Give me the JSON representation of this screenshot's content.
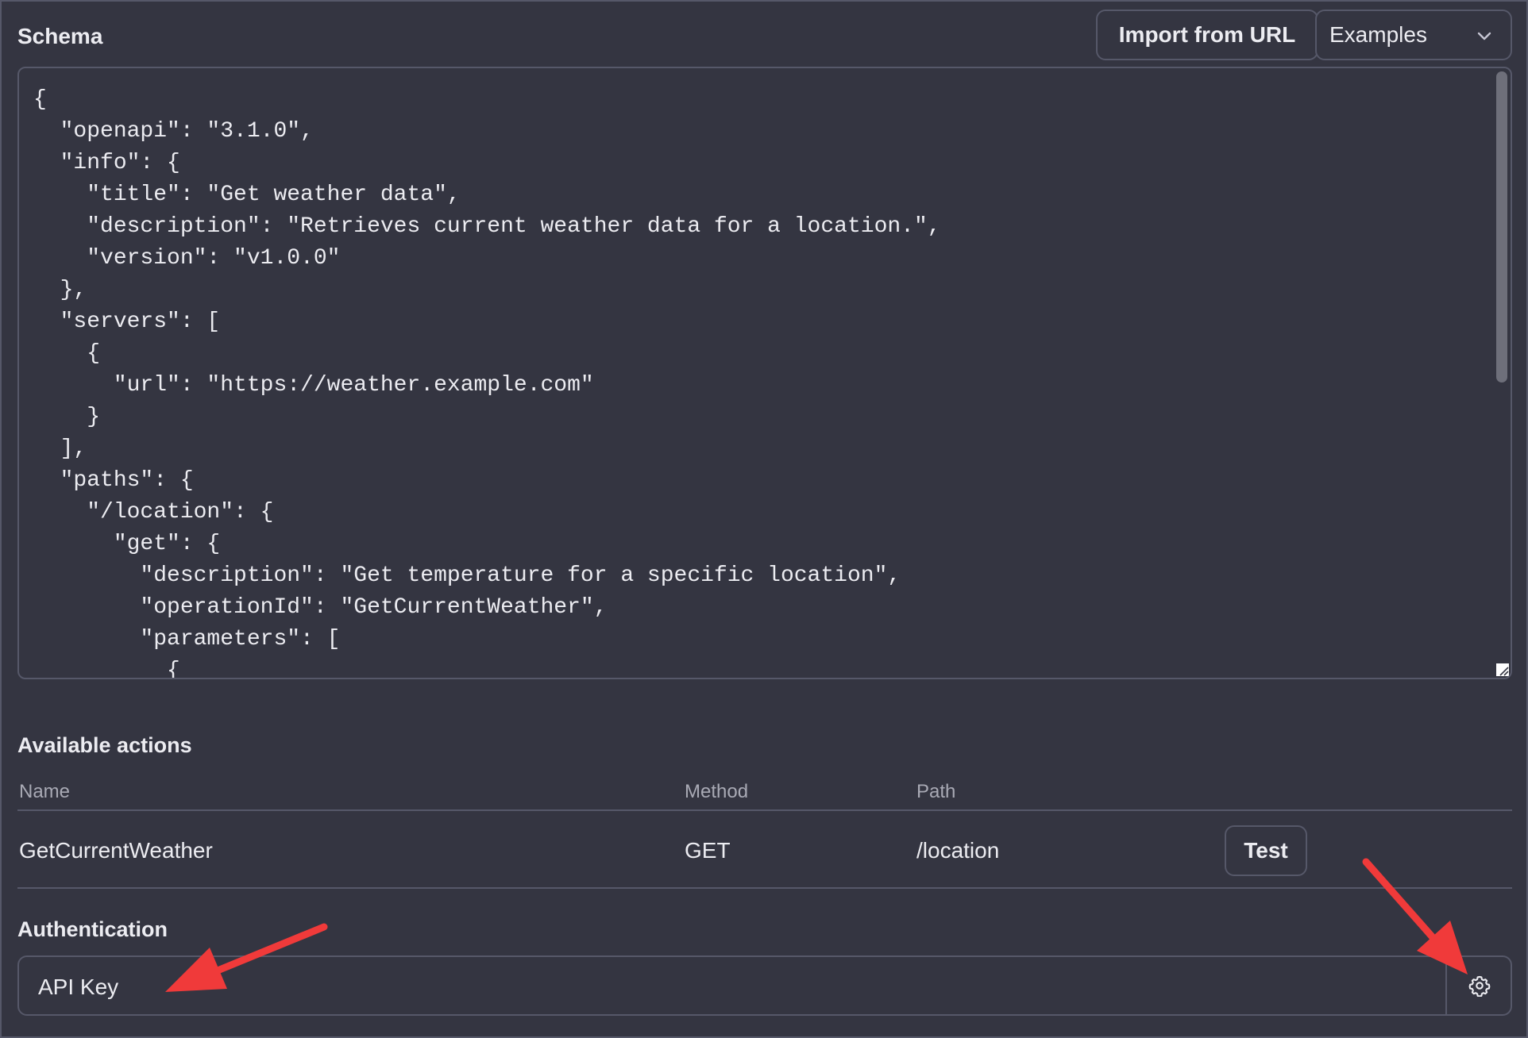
{
  "schema": {
    "title": "Schema",
    "import_button": "Import from URL",
    "examples_select": "Examples",
    "code_lines": [
      "{",
      "  \"openapi\": \"3.1.0\",",
      "  \"info\": {",
      "    \"title\": \"Get weather data\",",
      "    \"description\": \"Retrieves current weather data for a location.\",",
      "    \"version\": \"v1.0.0\"",
      "  },",
      "  \"servers\": [",
      "    {",
      "      \"url\": \"https://weather.example.com\"",
      "    }",
      "  ],",
      "  \"paths\": {",
      "    \"/location\": {",
      "      \"get\": {",
      "        \"description\": \"Get temperature for a specific location\",",
      "        \"operationId\": \"GetCurrentWeather\",",
      "        \"parameters\": [",
      "          {"
    ]
  },
  "actions": {
    "title": "Available actions",
    "headers": {
      "name": "Name",
      "method": "Method",
      "path": "Path"
    },
    "rows": [
      {
        "name": "GetCurrentWeather",
        "method": "GET",
        "path": "/location",
        "test_label": "Test"
      }
    ]
  },
  "authentication": {
    "title": "Authentication",
    "value": "API Key",
    "settings_icon": "gear-icon"
  },
  "colors": {
    "background": "#343541",
    "border": "#565869",
    "text": "#ececf1",
    "muted_text": "#a9aab5",
    "annotation_arrow": "#f03a3a"
  }
}
